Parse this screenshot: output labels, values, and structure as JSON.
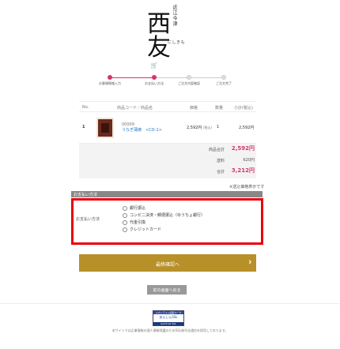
{
  "brand": {
    "logo_small": "近江今津",
    "logo_kanji": "西友",
    "logo_kana": "にしきも"
  },
  "steps": [
    {
      "label": "お客様情報入力",
      "active": true
    },
    {
      "label": "お支払い方法",
      "active": true
    },
    {
      "label": "ご注文内容確認",
      "active": false
    },
    {
      "label": "ご注文完了",
      "active": false
    }
  ],
  "steps_cart_icon": "cart-icon",
  "table": {
    "headers": {
      "no": "No.",
      "code": "商品コード／商品名",
      "price": "価格",
      "qty": "数量",
      "subtotal": "小計(税込)"
    },
    "row": {
      "no": "1",
      "code": "00009",
      "name": "うなぎ蒲焼　<CO-1>",
      "price": "2,592円",
      "price_tax": "(税込)",
      "qty": "1",
      "subtotal": "2,592円"
    },
    "totals": {
      "goods_label": "商品合計",
      "goods_value": "2,592円",
      "shipping_label": "送料",
      "shipping_value": "620円",
      "total_label": "合計",
      "total_value": "3,212円"
    }
  },
  "note": "※送込価格表示です",
  "payment": {
    "header": "お支払い方法",
    "label": "お支払い方法",
    "options": [
      "銀行振込",
      "コンビニ決済・郵便振込（ゆうちょ銀行）",
      "代金引換",
      "クレジットカード"
    ]
  },
  "confirm_button": "最終確認へ",
  "back_button": "前の画面へ戻る",
  "seal": {
    "top": "ジオトラスト認証マーク",
    "mid": "あんしんSSL",
    "bot": "GeoTrust SSL"
  },
  "copyright": "本サイトでは企業情報の個人情報保護のためSSL暗号化通信を採用しております。",
  "colors": {
    "accent": "#d6336c",
    "gold": "#b8902a",
    "frame": "#e8000b"
  }
}
